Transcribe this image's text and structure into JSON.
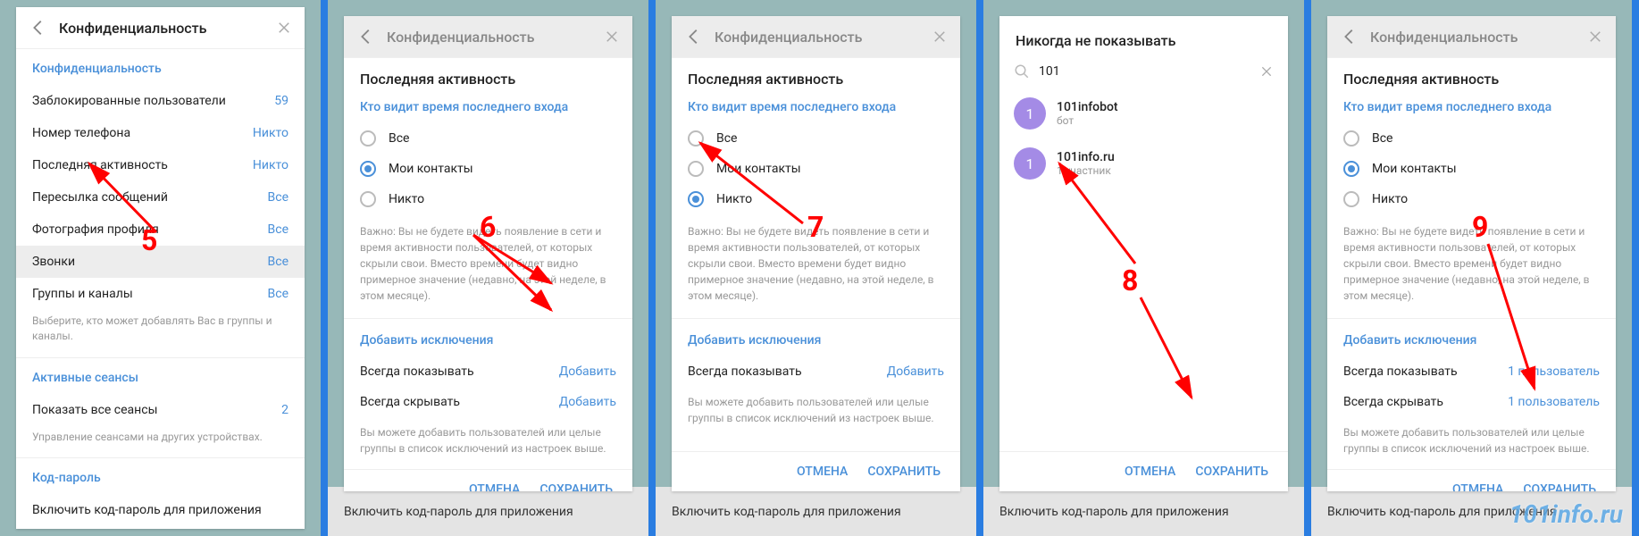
{
  "p1": {
    "title": "Конфиденциальность",
    "section1": "Конфиденциальность",
    "rows": [
      {
        "label": "Заблокированные пользователи",
        "value": "59"
      },
      {
        "label": "Номер телефона",
        "value": "Никто"
      },
      {
        "label": "Последняя активность",
        "value": "Никто"
      },
      {
        "label": "Пересылка сообщений",
        "value": "Все"
      },
      {
        "label": "Фотография профиля",
        "value": "Все"
      },
      {
        "label": "Звонки",
        "value": "Все"
      },
      {
        "label": "Группы и каналы",
        "value": "Все"
      }
    ],
    "hint1": "Выберите, кто может добавлять Вас в группы и каналы.",
    "section2": "Активные сеансы",
    "sessions_label": "Показать все сеансы",
    "sessions_value": "2",
    "hint2": "Управление сеансами на других устройствах.",
    "section3": "Код-пароль",
    "code_label": "Включить код-пароль для приложения"
  },
  "p2": {
    "back_title": "Конфиденциальность",
    "sub_title": "Последняя активность",
    "who": "Кто видит время последнего входа",
    "opts": [
      "Все",
      "Мои контакты",
      "Никто"
    ],
    "selected": 1,
    "note": "Важно: Вы не будете видеть появление в сети и время активности пользователей, от которых скрыли свои. Вместо времени будет видно примерное значение (недавно, на этой неделе, в этом месяце).",
    "exc_title": "Добавить исключения",
    "always_show": "Всегда показывать",
    "always_hide": "Всегда скрывать",
    "add": "Добавить",
    "exc_note": "Вы можете добавить пользователей или целые группы в список исключений из настроек выше.",
    "cancel": "ОТМЕНА",
    "save": "СОХРАНИТЬ",
    "bg": "Включить код-пароль для приложения"
  },
  "p3": {
    "selected": 2
  },
  "p4": {
    "title": "Никогда не показывать",
    "search": "101",
    "results": [
      {
        "initial": "1",
        "name": "101infobot",
        "sub": "бот"
      },
      {
        "initial": "1",
        "name": "101info.ru",
        "sub": "1 участник"
      }
    ],
    "cancel": "ОТМЕНА",
    "save": "СОХРАНИТЬ",
    "bg": "Включить код-пароль для приложения"
  },
  "p5": {
    "selected": 1,
    "always_show_val": "1 пользователь",
    "always_hide_val": "1 пользователь"
  },
  "annotations": [
    "5",
    "6",
    "7",
    "8",
    "9"
  ],
  "watermark": "101info.ru"
}
